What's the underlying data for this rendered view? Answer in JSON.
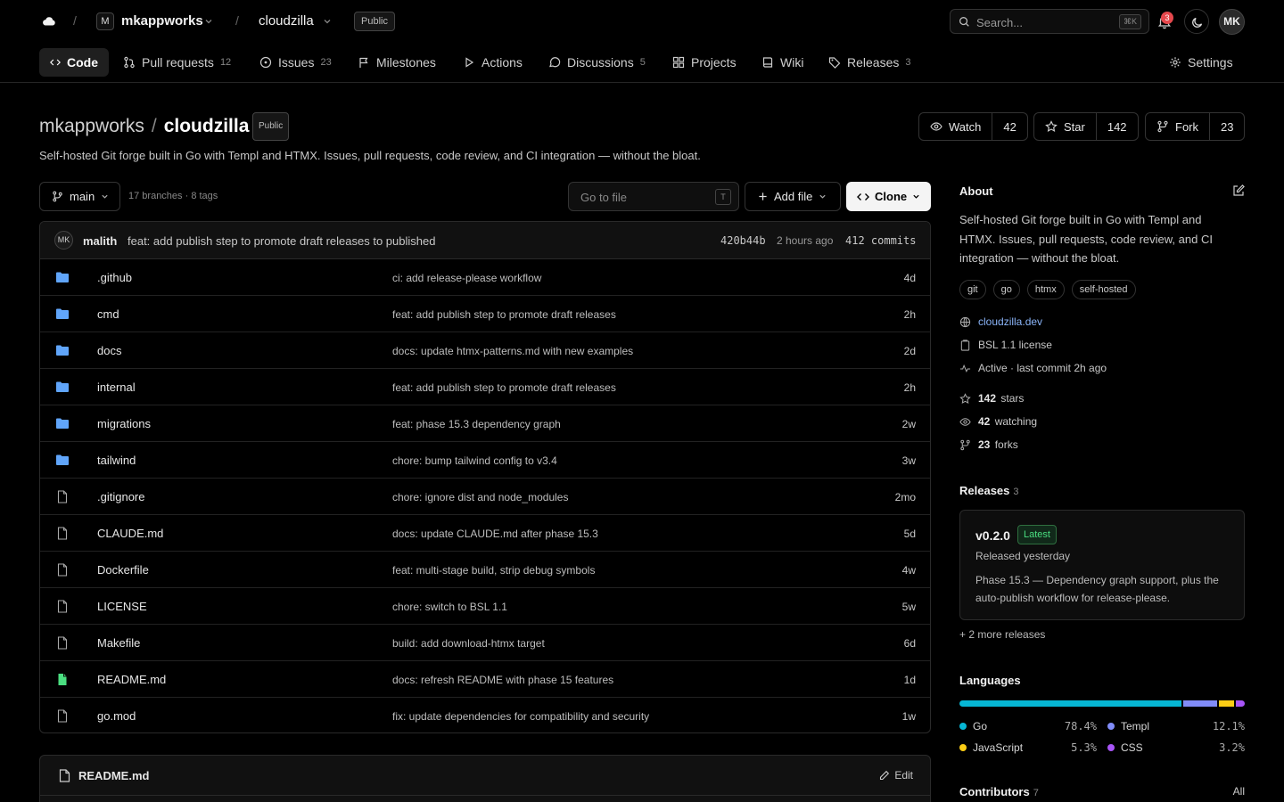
{
  "topbar": {
    "org": "mkappworks",
    "org_initial": "M",
    "repo": "cloudzilla",
    "visibility": "Public",
    "search_placeholder": "Search...",
    "search_kbd": "⌘K",
    "notifications": "3",
    "user_initials": "MK"
  },
  "tabs": [
    {
      "label": "Code",
      "count": ""
    },
    {
      "label": "Pull requests",
      "count": "12"
    },
    {
      "label": "Issues",
      "count": "23"
    },
    {
      "label": "Milestones",
      "count": ""
    },
    {
      "label": "Actions",
      "count": ""
    },
    {
      "label": "Discussions",
      "count": "5"
    },
    {
      "label": "Projects",
      "count": ""
    },
    {
      "label": "Wiki",
      "count": ""
    },
    {
      "label": "Releases",
      "count": "3"
    }
  ],
  "settings_label": "Settings",
  "repo": {
    "owner": "mkappworks",
    "name": "cloudzilla",
    "separator": "/",
    "visibility": "Public",
    "description": "Self-hosted Git forge built in Go with Templ and HTMX. Issues, pull requests, code review, and CI integration — without the bloat.",
    "watch_label": "Watch",
    "watch_count": "42",
    "star_label": "Star",
    "star_count": "142",
    "fork_label": "Fork",
    "fork_count": "23"
  },
  "toolbar": {
    "branch": "main",
    "branch_meta": "17 branches · 8 tags",
    "goto_placeholder": "Go to file",
    "goto_kbd": "T",
    "add_file": "Add file",
    "clone": "Clone"
  },
  "latest_commit": {
    "author_initials": "MK",
    "author": "malith",
    "message": "feat: add publish step to promote draft releases to published",
    "sha": "420b44b",
    "time": "2 hours ago",
    "count": "412 commits"
  },
  "files": [
    {
      "name": ".github",
      "type": "folder",
      "message": "ci: add release-please workflow",
      "age": "4d"
    },
    {
      "name": "cmd",
      "type": "folder",
      "message": "feat: add publish step to promote draft releases",
      "age": "2h"
    },
    {
      "name": "docs",
      "type": "folder",
      "message": "docs: update htmx-patterns.md with new examples",
      "age": "2d"
    },
    {
      "name": "internal",
      "type": "folder",
      "message": "feat: add publish step to promote draft releases",
      "age": "2h"
    },
    {
      "name": "migrations",
      "type": "folder",
      "message": "feat: phase 15.3 dependency graph",
      "age": "2w"
    },
    {
      "name": "tailwind",
      "type": "folder",
      "message": "chore: bump tailwind config to v3.4",
      "age": "3w"
    },
    {
      "name": ".gitignore",
      "type": "file",
      "message": "chore: ignore dist and node_modules",
      "age": "2mo"
    },
    {
      "name": "CLAUDE.md",
      "type": "file",
      "message": "docs: update CLAUDE.md after phase 15.3",
      "age": "5d"
    },
    {
      "name": "Dockerfile",
      "type": "file",
      "message": "feat: multi-stage build, strip debug symbols",
      "age": "4w"
    },
    {
      "name": "LICENSE",
      "type": "file",
      "message": "chore: switch to BSL 1.1",
      "age": "5w"
    },
    {
      "name": "Makefile",
      "type": "file",
      "message": "build: add download-htmx target",
      "age": "6d"
    },
    {
      "name": "README.md",
      "type": "readme",
      "message": "docs: refresh README with phase 15 features",
      "age": "1d"
    },
    {
      "name": "go.mod",
      "type": "file",
      "message": "fix: update dependencies for compatibility and security",
      "age": "1w"
    }
  ],
  "readme": {
    "name": "README.md",
    "edit": "Edit"
  },
  "about": {
    "heading": "About",
    "text": "Self-hosted Git forge built in Go with Templ and HTMX. Issues, pull requests, code review, and CI integration — without the bloat.",
    "topics": [
      "git",
      "go",
      "htmx",
      "self-hosted"
    ],
    "website": "cloudzilla.dev",
    "license": "BSL 1.1 license",
    "activity": "Active · last commit 2h ago",
    "stars": "142",
    "stars_label": "stars",
    "watching": "42",
    "watching_label": "watching",
    "forks": "23",
    "forks_label": "forks"
  },
  "releases": {
    "heading": "Releases",
    "count": "3",
    "version": "v0.2.0",
    "badge": "Latest",
    "date": "Released yesterday",
    "notes": "Phase 15.3 — Dependency graph support, plus the auto-publish workflow for release-please.",
    "more": "+ 2 more releases"
  },
  "languages": {
    "heading": "Languages",
    "items": [
      {
        "name": "Go",
        "percent": "78.4%",
        "value": 78.4,
        "color": "#06b6d4"
      },
      {
        "name": "Templ",
        "percent": "12.1%",
        "value": 12.1,
        "color": "#818cf8"
      },
      {
        "name": "JavaScript",
        "percent": "5.3%",
        "value": 5.3,
        "color": "#facc15"
      },
      {
        "name": "CSS",
        "percent": "3.2%",
        "value": 3.2,
        "color": "#a855f7"
      }
    ]
  },
  "contributors": {
    "heading": "Contributors",
    "count": "7",
    "all": "All"
  }
}
